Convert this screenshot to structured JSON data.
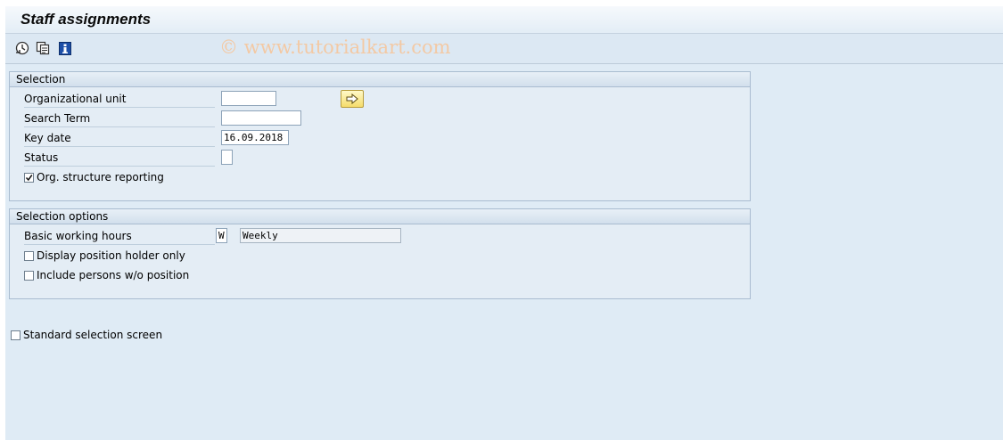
{
  "window": {
    "title": "Staff assignments"
  },
  "watermark": "© www.tutorialkart.com",
  "toolbar": {
    "buttons": [
      {
        "icon": "execute-clock-icon"
      },
      {
        "icon": "copy-variant-icon"
      },
      {
        "icon": "info-icon"
      }
    ]
  },
  "selection": {
    "title": "Selection",
    "org_unit_label": "Organizational unit",
    "org_unit_value": "",
    "search_term_label": "Search Term",
    "search_term_value": "",
    "key_date_label": "Key date",
    "key_date_value": "16.09.2018",
    "status_label": "Status",
    "status_value": "",
    "org_structure_label": "Org. structure reporting",
    "org_structure_checked": true,
    "search_button_icon": "arrow-right-icon"
  },
  "selection_options": {
    "title": "Selection options",
    "working_hours_label": "Basic working hours",
    "working_hours_code": "W",
    "working_hours_text": "Weekly",
    "position_holder_label": "Display position holder only",
    "position_holder_checked": false,
    "persons_wo_position_label": "Include persons w/o position",
    "persons_wo_position_checked": false
  },
  "standard_selection_label": "Standard selection screen",
  "standard_selection_checked": false
}
